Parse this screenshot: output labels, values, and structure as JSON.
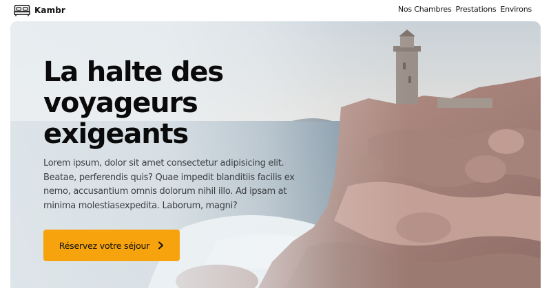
{
  "header": {
    "brand": {
      "name": "Kambr",
      "icon": "bed-icon"
    },
    "nav": [
      {
        "label": "Nos Chambres"
      },
      {
        "label": "Prestations"
      },
      {
        "label": "Environs"
      }
    ]
  },
  "hero": {
    "title": "La halte des voyageurs exigeants",
    "text": "Lorem ipsum, dolor sit amet consectetur adipisicing elit. Beatae, perferendis quis? Quae impedit blanditiis facilis ex nemo, accusantium omnis dolorum nihil illo. Ad ipsam at minima molestiasexpedita. Laborum, magni?",
    "cta": {
      "label": "Réservez votre séjour",
      "icon": "chevron-right-icon"
    },
    "background": "coastal-lighthouse-photo"
  },
  "colors": {
    "accent": "#f7a30d",
    "text": "#111111",
    "body_text": "#3b3f44",
    "background": "#ffffff"
  }
}
